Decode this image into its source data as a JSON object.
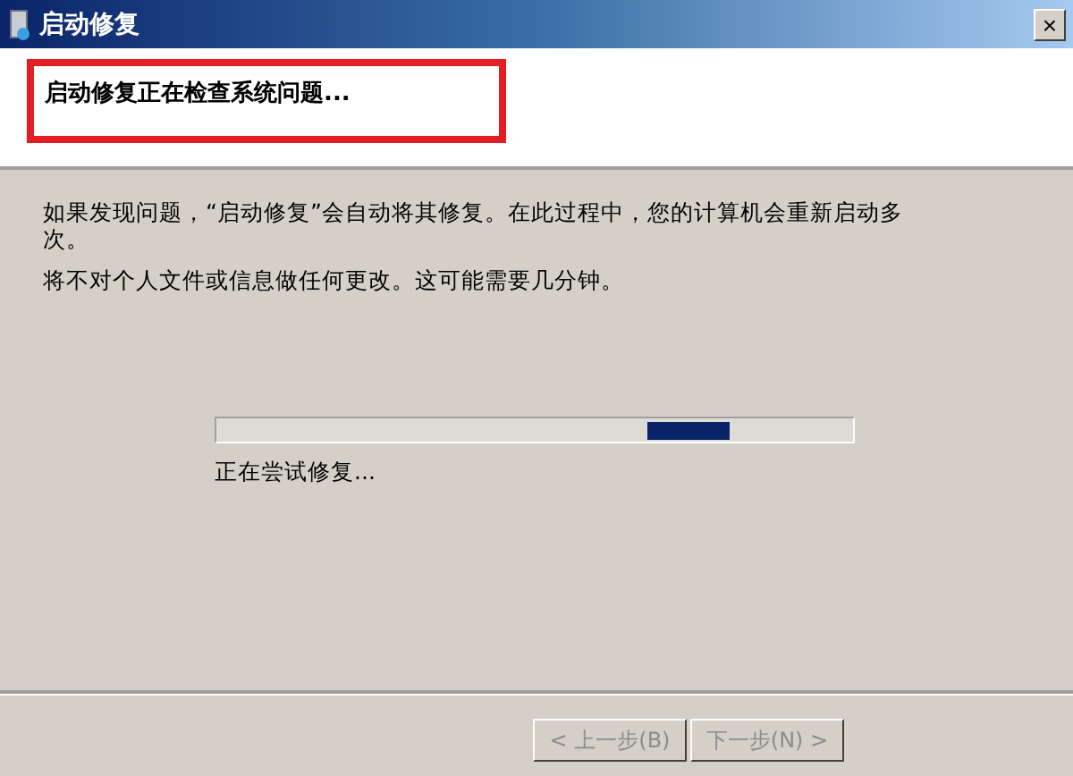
{
  "window": {
    "title": "启动修复",
    "close": "×"
  },
  "header": {
    "title": "启动修复正在检查系统问题..."
  },
  "body": {
    "paragraphs": [
      "如果发现问题，“启动修复”会自动将其修复。在此过程中，您的计算机会重新启动多次。",
      "将不对个人文件或信息做任何更改。这可能需要几分钟。"
    ]
  },
  "progress": {
    "kind": "marquee",
    "status": "正在尝试修复..."
  },
  "buttons": [
    {
      "label": "< 上一步(B)",
      "disabled": true
    },
    {
      "label": "下一步(N) >",
      "disabled": true
    }
  ]
}
